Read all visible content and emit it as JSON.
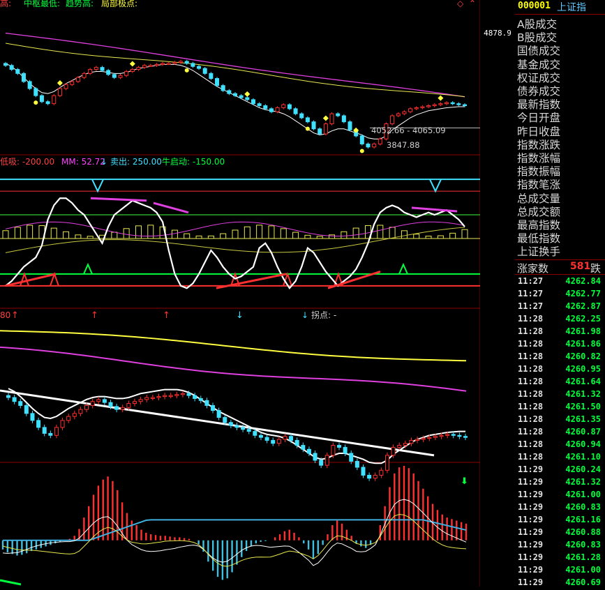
{
  "top_legend": {
    "a": "高:",
    "b": "中枢最低:",
    "c": "趋势高:",
    "d": "局部极点:"
  },
  "mid_legend": {
    "low": "低吸: -200.00",
    "mm": "MM: 52.72",
    "arrow": "↓",
    "sell": "卖出: 250.00",
    "bull": "牛启动: -150.00"
  },
  "p3_legend": {
    "num": "80",
    "turn": "拐点: -"
  },
  "annotations": {
    "range": "4052.66 - 4065.09",
    "low": "3847.88",
    "cursor": "4878.9"
  },
  "sidebar": {
    "code": "000001",
    "name": "上证指",
    "fields": [
      "A股成交",
      "B股成交",
      "国债成交",
      "基金成交",
      "权证成交",
      "债券成交",
      "最新指数",
      "今日开盘",
      "昨日收盘",
      "指数涨跌",
      "指数涨幅",
      "指数振幅",
      "指数笔涨",
      "总成交量",
      "总成交额",
      "最高指数",
      "最低指数",
      "上证换手"
    ],
    "zj_label": "涨家数",
    "zj_value": "581",
    "zj_tail": "跌"
  },
  "ticks": [
    {
      "t": "11:27",
      "p": "4262.84"
    },
    {
      "t": "11:27",
      "p": "4262.77"
    },
    {
      "t": "11:27",
      "p": "4262.87"
    },
    {
      "t": "11:28",
      "p": "4262.25"
    },
    {
      "t": "11:28",
      "p": "4261.98"
    },
    {
      "t": "11:28",
      "p": "4261.86"
    },
    {
      "t": "11:28",
      "p": "4260.82"
    },
    {
      "t": "11:28",
      "p": "4260.95"
    },
    {
      "t": "11:28",
      "p": "4261.64"
    },
    {
      "t": "11:28",
      "p": "4261.32"
    },
    {
      "t": "11:28",
      "p": "4261.50"
    },
    {
      "t": "11:28",
      "p": "4261.35"
    },
    {
      "t": "11:28",
      "p": "4260.87"
    },
    {
      "t": "11:28",
      "p": "4260.94"
    },
    {
      "t": "11:28",
      "p": "4261.10"
    },
    {
      "t": "11:29",
      "p": "4260.24"
    },
    {
      "t": "11:29",
      "p": "4261.32"
    },
    {
      "t": "11:29",
      "p": "4261.00"
    },
    {
      "t": "11:29",
      "p": "4260.83"
    },
    {
      "t": "11:29",
      "p": "4261.16"
    },
    {
      "t": "11:29",
      "p": "4260.88"
    },
    {
      "t": "11:29",
      "p": "4260.83"
    },
    {
      "t": "11:29",
      "p": "4261.28"
    },
    {
      "t": "11:29",
      "p": "4261.00"
    },
    {
      "t": "11:29",
      "p": "4260.69"
    }
  ],
  "chart_data": [
    {
      "type": "candlestick",
      "panel": "main",
      "y_ticks": [
        "5200",
        "5000",
        "4800",
        "4600",
        "4400",
        "4200",
        "4000"
      ],
      "ylim": [
        3820,
        5260
      ],
      "closes": [
        4680,
        4640,
        4600,
        4520,
        4450,
        4380,
        4320,
        4300,
        4380,
        4450,
        4490,
        4520,
        4560,
        4600,
        4640,
        4660,
        4630,
        4590,
        4560,
        4580,
        4620,
        4640,
        4660,
        4680,
        4680,
        4690,
        4700,
        4700,
        4710,
        4720,
        4700,
        4670,
        4650,
        4600,
        4550,
        4480,
        4430,
        4400,
        4380,
        4360,
        4340,
        4300,
        4280,
        4250,
        4220,
        4260,
        4290,
        4250,
        4200,
        4160,
        4120,
        4050,
        4000,
        4100,
        4200,
        4180,
        4120,
        4040,
        3980,
        3900,
        3870,
        3900,
        3950,
        4100,
        4180,
        4200,
        4220,
        4250,
        4260,
        4270,
        4280,
        4290,
        4300,
        4310,
        4300,
        4290,
        4280
      ],
      "ma_white": [
        4700,
        4670,
        4620,
        4560,
        4500,
        4450,
        4410,
        4400,
        4420,
        4460,
        4500,
        4530,
        4560,
        4590,
        4610,
        4620,
        4620,
        4610,
        4600,
        4600,
        4610,
        4630,
        4650,
        4660,
        4670,
        4680,
        4690,
        4690,
        4690,
        4680,
        4660,
        4630,
        4590,
        4550,
        4510,
        4470,
        4440,
        4410,
        4380,
        4350,
        4320,
        4290,
        4260,
        4240,
        4230,
        4220,
        4200,
        4170,
        4130,
        4090,
        4050,
        4010,
        3990,
        4000,
        4030,
        4050,
        4050,
        4030,
        4010,
        3990,
        3960,
        3950,
        3950,
        3980,
        4040,
        4080,
        4120,
        4160,
        4190,
        4210,
        4230,
        4240,
        4250,
        4260,
        4265,
        4270,
        4270
      ],
      "ma_yellow_start": 4900,
      "ma_yellow_end": 4350,
      "ma_magenta_start": 5000,
      "ma_magenta_end": 4360,
      "ref_line": 4060
    },
    {
      "type": "line",
      "panel": "oscillator",
      "y_ticks": [
        "300.0",
        "200.0",
        "100.0",
        "0.00",
        "-100.0",
        "-200.0"
      ],
      "ylim": [
        -230,
        330
      ],
      "levels": {
        "sell": 250,
        "low_buy": -200,
        "bull": -150,
        "mid": 100,
        "zero": 0
      },
      "white": [
        -200,
        -180,
        -150,
        -120,
        -100,
        -80,
        -30,
        80,
        140,
        170,
        170,
        150,
        120,
        100,
        60,
        20,
        -20,
        50,
        100,
        120,
        140,
        160,
        150,
        140,
        130,
        110,
        70,
        -50,
        -150,
        -200,
        -210,
        -190,
        -150,
        -100,
        -50,
        -80,
        -120,
        -150,
        -170,
        -160,
        -140,
        -120,
        -40,
        -20,
        -60,
        -120,
        -170,
        -210,
        -180,
        -120,
        -40,
        -60,
        -100,
        -140,
        -170,
        -200,
        -180,
        -160,
        -130,
        -80,
        -20,
        60,
        110,
        130,
        140,
        130,
        110,
        100,
        90,
        100,
        110,
        100,
        110,
        120,
        100,
        80,
        50
      ],
      "mm": [
        52.72
      ]
    },
    {
      "type": "candlestick",
      "panel": "weekly",
      "y_ticks": [
        "5000",
        "4750",
        "4500",
        "4250",
        "4000"
      ],
      "ylim": [
        3850,
        5250
      ],
      "trendline": [
        4550,
        3900
      ],
      "yellow_start": 5150,
      "yellow_end": 4840,
      "magenta_start": 4960,
      "magenta_end": 4530
    },
    {
      "type": "bar",
      "panel": "macd",
      "y_ticks": [
        "50.00",
        "25.00",
        "0.00",
        "-25.00",
        "-50.00"
      ],
      "ylim": [
        -58,
        98
      ],
      "hist": [
        -12,
        -16,
        -18,
        -20,
        -19,
        -17,
        -14,
        -12,
        -10,
        -8,
        -6,
        -4,
        -2,
        0,
        2,
        6,
        15,
        30,
        45,
        60,
        72,
        80,
        84,
        78,
        66,
        50,
        36,
        26,
        20,
        14,
        10,
        8,
        7,
        6,
        6,
        5,
        4,
        4,
        3,
        2,
        0,
        -5,
        -15,
        -28,
        -40,
        -48,
        -52,
        -50,
        -42,
        -32,
        -22,
        -14,
        -8,
        -4,
        -2,
        -1,
        0,
        4,
        8,
        12,
        14,
        10,
        4,
        -4,
        -12,
        -24,
        -18,
        -6,
        8,
        20,
        26,
        22,
        14,
        6,
        -4,
        -8,
        -10,
        -6,
        0,
        20,
        45,
        70,
        88,
        96,
        98,
        95,
        88,
        78,
        68,
        58,
        48,
        40,
        34,
        30,
        28,
        26,
        24,
        22
      ],
      "line_cyan_level": 27,
      "dea_end": 18
    }
  ]
}
